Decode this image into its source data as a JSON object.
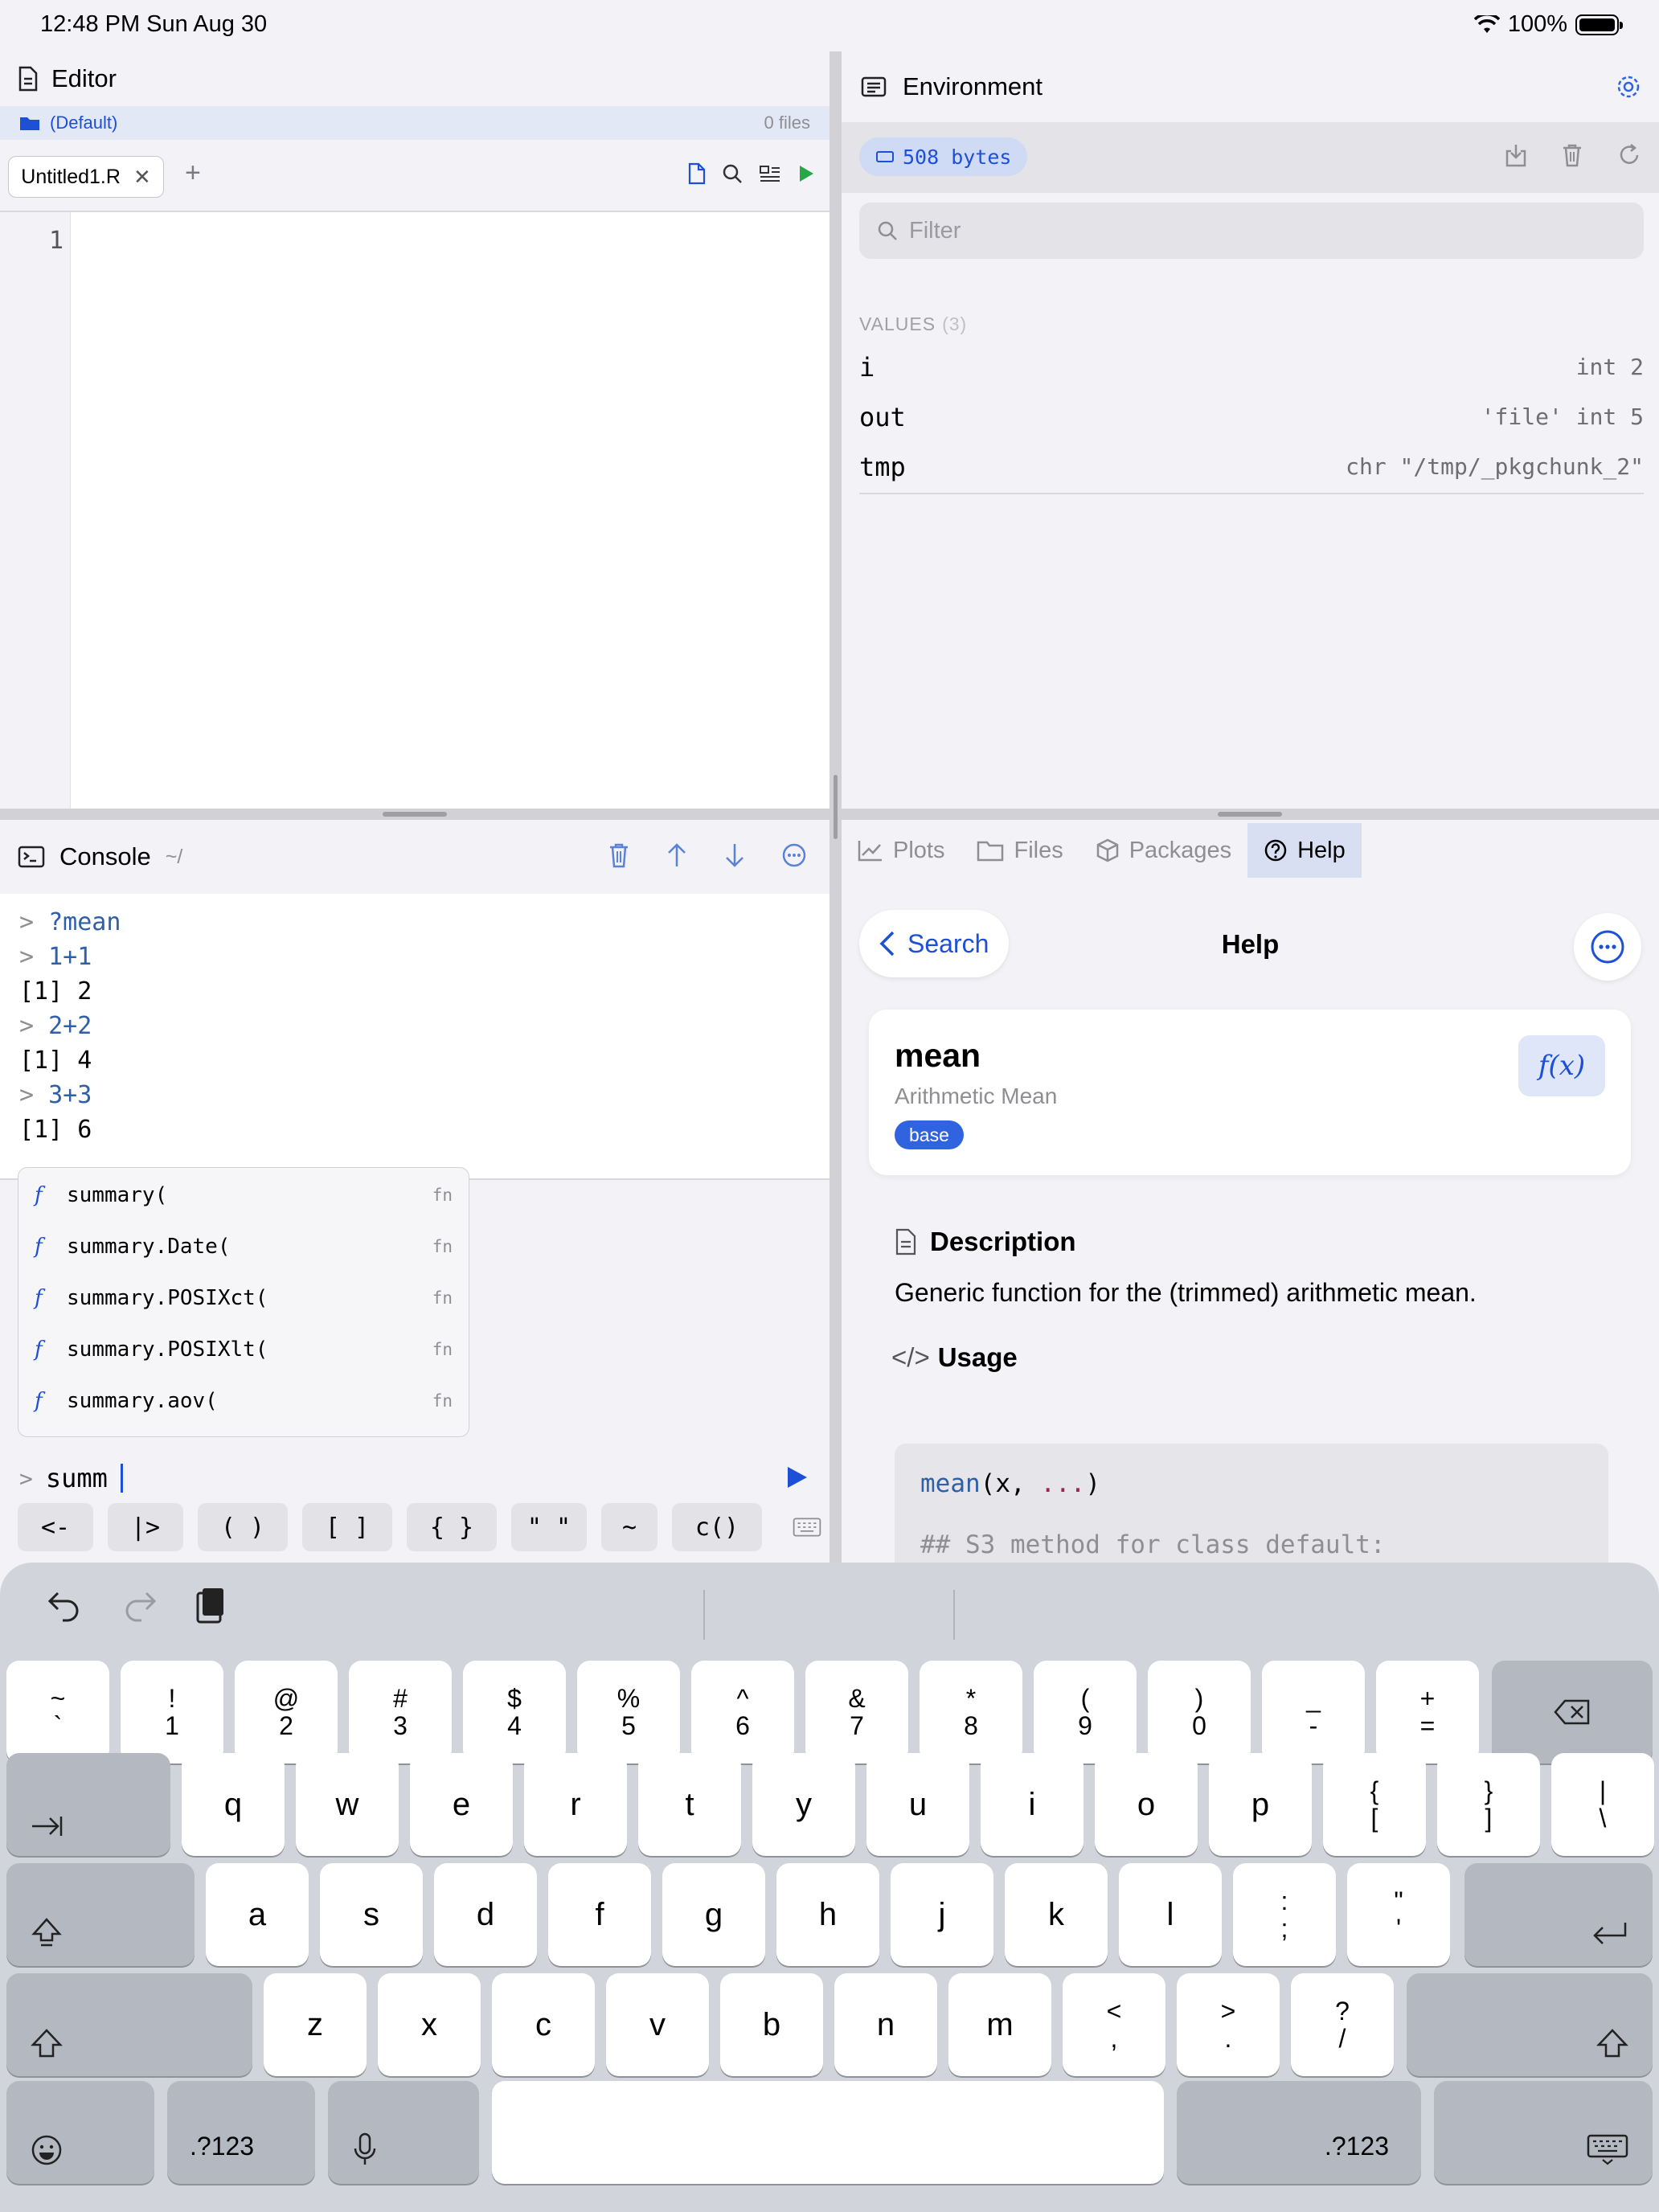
{
  "status": {
    "time_date": "12:48 PM   Sun Aug 30",
    "battery": "100%"
  },
  "editor": {
    "title": "Editor",
    "project": "(Default)",
    "file_count": "0 files",
    "tab": "Untitled1.R",
    "line_number": "1"
  },
  "environment": {
    "title": "Environment",
    "memory": "508 bytes",
    "filter_placeholder": "Filter",
    "values_header": "VALUES",
    "values_count": "(3)",
    "rows": [
      {
        "name": "i",
        "value": "int 2"
      },
      {
        "name": "out",
        "value": "'file' int 5"
      },
      {
        "name": "tmp",
        "value": "chr \"/tmp/_pkgchunk_2\""
      }
    ]
  },
  "console": {
    "title": "Console",
    "path": "~/",
    "lines": [
      {
        "prompt": "> ",
        "text": "?mean",
        "kind": "cmd"
      },
      {
        "prompt": "> ",
        "text": "1+1",
        "kind": "cmd"
      },
      {
        "prompt": "",
        "text": "[1] 2",
        "kind": "out"
      },
      {
        "prompt": "> ",
        "text": "2+2",
        "kind": "cmd"
      },
      {
        "prompt": "",
        "text": "[1] 4",
        "kind": "out"
      },
      {
        "prompt": "> ",
        "text": "3+3",
        "kind": "cmd"
      },
      {
        "prompt": "",
        "text": "[1] 6",
        "kind": "out"
      }
    ],
    "completions": [
      {
        "label": "summary(",
        "kind": "fn"
      },
      {
        "label": "summary.Date(",
        "kind": "fn"
      },
      {
        "label": "summary.POSIXct(",
        "kind": "fn"
      },
      {
        "label": "summary.POSIXlt(",
        "kind": "fn"
      },
      {
        "label": "summary.aov(",
        "kind": "fn"
      }
    ],
    "input_prompt": ">",
    "input_value": "summ",
    "snippets": [
      "<-",
      "|>",
      "( )",
      "[ ]",
      "{ }",
      "\" \"",
      "~",
      "c()"
    ]
  },
  "aux": {
    "tabs": [
      "Plots",
      "Files",
      "Packages",
      "Help"
    ],
    "active_tab": "Help",
    "back_label": "Search",
    "help_title": "Help",
    "fn_name": "mean",
    "fn_title": "Arithmetic Mean",
    "fn_package": "base",
    "fx_label": "f(x)",
    "description_heading": "Description",
    "description": "Generic function for the (trimmed) arithmetic mean.",
    "usage_heading": "Usage",
    "usage_fn": "mean",
    "usage_args_open": "(x, ",
    "usage_dots": "...",
    "usage_args_close": ")",
    "usage_comment": "## S3 method for class default:"
  },
  "keyboard": {
    "row1": [
      [
        "~",
        "`"
      ],
      [
        "!",
        "1"
      ],
      [
        "@",
        "2"
      ],
      [
        "#",
        "3"
      ],
      [
        "$",
        "4"
      ],
      [
        "%",
        "5"
      ],
      [
        "^",
        "6"
      ],
      [
        "&",
        "7"
      ],
      [
        "*",
        "8"
      ],
      [
        "(",
        "9"
      ],
      [
        ")",
        "0"
      ],
      [
        "_",
        "-"
      ],
      [
        "+",
        "="
      ]
    ],
    "row2": [
      "q",
      "w",
      "e",
      "r",
      "t",
      "y",
      "u",
      "i",
      "o",
      "p"
    ],
    "row2_dual": [
      [
        "{",
        "["
      ],
      [
        "}",
        "]"
      ],
      [
        "|",
        "\\"
      ]
    ],
    "row3": [
      "a",
      "s",
      "d",
      "f",
      "g",
      "h",
      "j",
      "k",
      "l"
    ],
    "row3_dual": [
      [
        ":",
        ";"
      ],
      [
        "\"",
        "'"
      ]
    ],
    "row4": [
      "z",
      "x",
      "c",
      "v",
      "b",
      "n",
      "m"
    ],
    "row4_dual": [
      [
        "<",
        ","
      ],
      [
        ">",
        "."
      ],
      [
        "?",
        "/"
      ]
    ],
    "numbers_label": ".?123"
  }
}
